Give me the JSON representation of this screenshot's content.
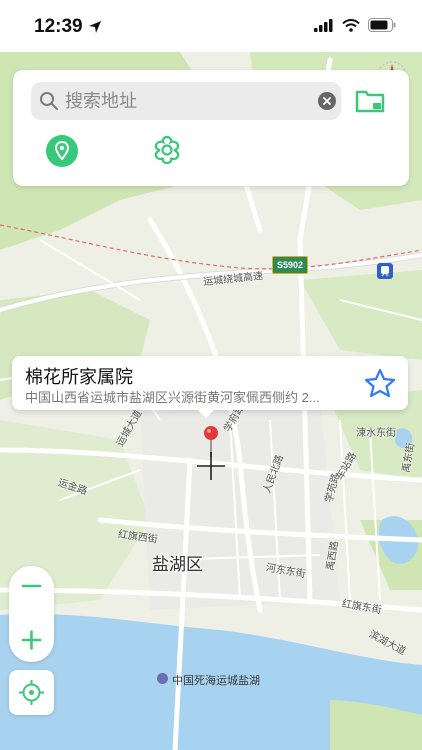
{
  "status_bar": {
    "time": "12:39"
  },
  "search": {
    "placeholder": "搜索地址",
    "value": ""
  },
  "icons": {
    "location_arrow": "location-arrow-icon",
    "signal": "cellular-signal-icon",
    "wifi": "wifi-icon",
    "battery": "battery-icon",
    "search": "search-icon",
    "clear": "clear-icon",
    "folder": "folder-icon",
    "pin": "location-pin-icon",
    "settings": "flower-settings-icon",
    "favorite": "star-icon",
    "zoom_out": "minus-icon",
    "zoom_in": "plus-icon",
    "locate": "crosshair-locate-icon"
  },
  "popup": {
    "title": "棉花所家属院",
    "address": "中国山西省运城市盐湖区兴源街黄河家佩西侧约 2..."
  },
  "map_labels": {
    "district": "盐湖区",
    "highway_name": "运城绕城高速",
    "highway_shield": "S5902",
    "road_1": "涑水东街",
    "road_2": "人民北路",
    "road_3": "运金路",
    "road_4": "红旗西街",
    "road_5": "河东东街",
    "road_6": "红旗东街",
    "road_7": "禹西路",
    "road_8": "滨湖大道",
    "road_9": "学苑路",
    "road_10": "禹东街",
    "road_11": "运城大道",
    "road_12": "学府路",
    "road_13": "车站路",
    "saltlake": "中国死海运城盐湖"
  },
  "colors": {
    "accent_green": "#38c97a",
    "favorite_blue": "#2f7cf6",
    "water": "#a8d3f0",
    "marker_red": "#e53935"
  }
}
